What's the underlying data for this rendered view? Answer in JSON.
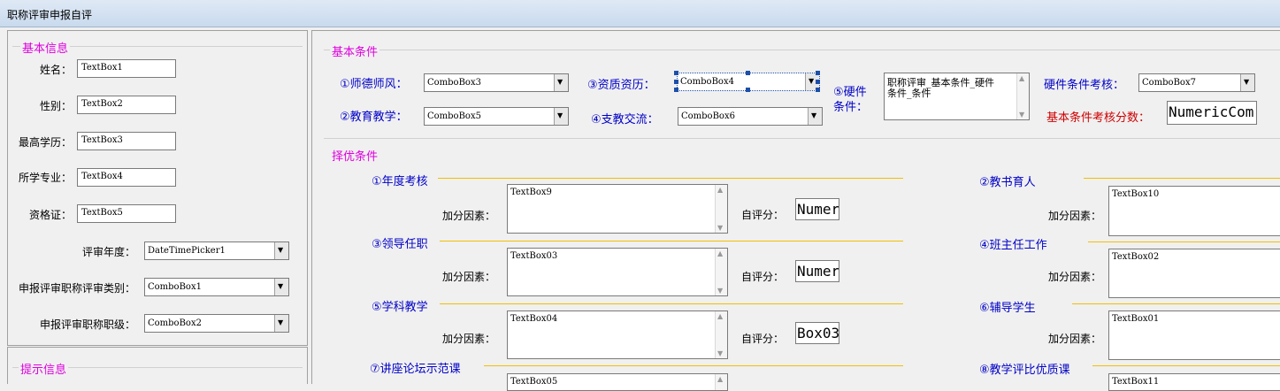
{
  "window": {
    "title": "职称评审申报自评"
  },
  "basic_info": {
    "group_title": "基本信息",
    "fields": [
      {
        "label": "姓名：",
        "value": "TextBox1"
      },
      {
        "label": "性别：",
        "value": "TextBox2"
      },
      {
        "label": "最高学历：",
        "value": "TextBox3"
      },
      {
        "label": "所学专业：",
        "value": "TextBox4"
      },
      {
        "label": "资格证：",
        "value": "TextBox5"
      }
    ],
    "combos": [
      {
        "label": "评审年度：",
        "value": "DateTimePicker1"
      },
      {
        "label": "申报评审职称评审类别：",
        "value": "ComboBox1"
      },
      {
        "label": "申报评审职称职级：",
        "value": "ComboBox2"
      }
    ]
  },
  "hint": {
    "group_title": "提示信息"
  },
  "basic_conditions": {
    "group_title": "基本条件",
    "c1_label": "①师德师风：",
    "c1_value": "ComboBox3",
    "c2_label": "②教育教学：",
    "c2_value": "ComboBox5",
    "c3_label": "③资质资历：",
    "c3_value": "ComboBox4",
    "c4_label": "④支教交流：",
    "c4_value": "ComboBox6",
    "c5_label_line1": "⑤硬件",
    "c5_label_line2": "条件：",
    "c5_text_line1": "职称评审_基本条件_硬件",
    "c5_text_line2": "条件_条件",
    "hw_check_label": "硬件条件考核：",
    "hw_check_value": "ComboBox7",
    "score_label": "基本条件考核分数：",
    "score_value": "NumericCom"
  },
  "preferred_conditions": {
    "group_title": "择优条件",
    "add_label": "加分因素：",
    "self_label": "自评分：",
    "left_items": [
      {
        "title": "①年度考核",
        "text": "TextBox9",
        "score": "Numer"
      },
      {
        "title": "③领导任职",
        "text": "TextBox03",
        "score": "Numer"
      },
      {
        "title": "⑤学科教学",
        "text": "TextBox04",
        "score": "Box03"
      },
      {
        "title": "⑦讲座论坛示范课",
        "text": "TextBox05"
      }
    ],
    "right_items": [
      {
        "title": "②教书育人",
        "text": "TextBox10"
      },
      {
        "title": "④班主任工作",
        "text": "TextBox02"
      },
      {
        "title": "⑥辅导学生",
        "text": "TextBox01"
      },
      {
        "title": "⑧教学评比优质课",
        "text": "TextBox11"
      }
    ]
  },
  "icons": {
    "dropdown": "chevron-down-icon",
    "scroll_up": "scroll-up-icon",
    "scroll_down": "scroll-down-icon"
  }
}
